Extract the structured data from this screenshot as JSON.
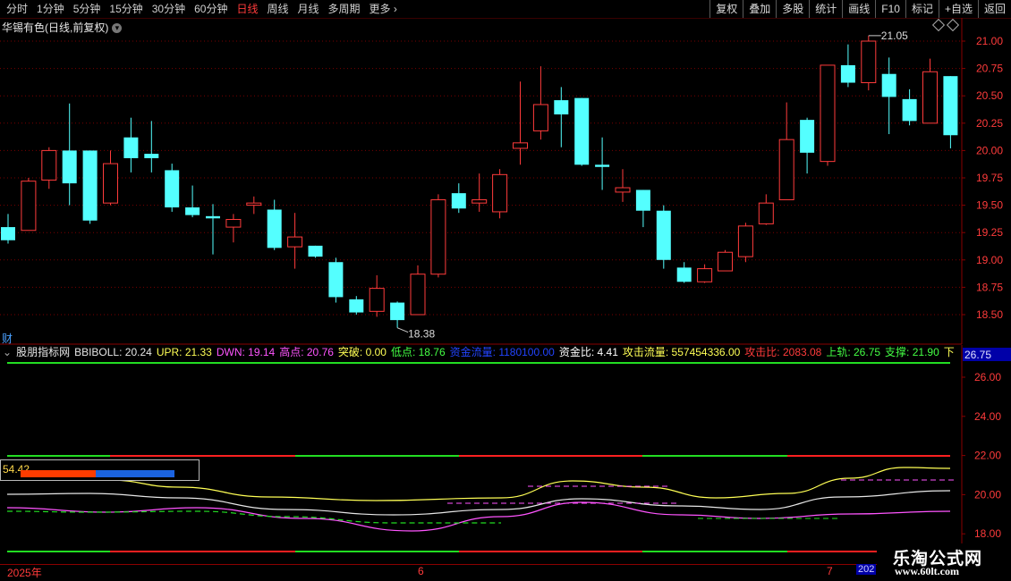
{
  "toolbar": {
    "periods": [
      "分时",
      "1分钟",
      "5分钟",
      "15分钟",
      "30分钟",
      "60分钟",
      "日线",
      "周线",
      "月线",
      "多周期",
      "更多 ›"
    ],
    "active_period": "日线",
    "right_buttons": [
      "复权",
      "叠加",
      "多股",
      "统计",
      "画线",
      "F10",
      "标记",
      "+自选",
      "返回"
    ]
  },
  "stock": {
    "title": "华锡有色(日线,前复权)"
  },
  "main_chart": {
    "price_axis": [
      "21.00",
      "20.75",
      "20.50",
      "20.25",
      "20.00",
      "19.75",
      "19.50",
      "19.25",
      "19.00",
      "18.75",
      "18.50"
    ],
    "high_label": "21.05",
    "low_label": "18.38",
    "up_color": "#ff3b3b",
    "down_color": "#54ffff",
    "candles": [
      [
        19.3,
        19.18,
        19.42,
        19.15
      ],
      [
        19.27,
        19.72,
        19.75,
        19.27
      ],
      [
        19.73,
        20.0,
        20.03,
        19.65
      ],
      [
        20.0,
        19.7,
        20.43,
        19.5
      ],
      [
        20.0,
        19.36,
        20.0,
        19.33
      ],
      [
        19.52,
        19.88,
        20.0,
        19.5
      ],
      [
        20.12,
        19.93,
        20.3,
        19.8
      ],
      [
        19.97,
        19.93,
        20.27,
        19.8
      ],
      [
        19.82,
        19.48,
        19.88,
        19.44
      ],
      [
        19.48,
        19.41,
        19.68,
        19.39
      ],
      [
        19.4,
        19.38,
        19.51,
        19.05
      ],
      [
        19.3,
        19.37,
        19.42,
        19.16
      ],
      [
        19.5,
        19.52,
        19.58,
        19.42
      ],
      [
        19.46,
        19.11,
        19.55,
        19.09
      ],
      [
        19.12,
        19.21,
        19.43,
        18.92
      ],
      [
        19.13,
        19.03,
        19.13,
        19.02
      ],
      [
        18.98,
        18.66,
        19.02,
        18.61
      ],
      [
        18.64,
        18.52,
        18.67,
        18.5
      ],
      [
        18.53,
        18.74,
        18.86,
        18.48
      ],
      [
        18.61,
        18.45,
        18.62,
        18.38
      ],
      [
        18.5,
        18.87,
        18.95,
        18.5
      ],
      [
        18.87,
        19.55,
        19.6,
        18.84
      ],
      [
        19.61,
        19.47,
        19.7,
        19.43
      ],
      [
        19.52,
        19.55,
        19.79,
        19.44
      ],
      [
        19.44,
        19.78,
        19.83,
        19.38
      ],
      [
        20.02,
        20.07,
        20.63,
        19.87
      ],
      [
        20.18,
        20.42,
        20.77,
        20.1
      ],
      [
        20.46,
        20.33,
        20.58,
        20.03
      ],
      [
        20.48,
        19.87,
        20.48,
        19.86
      ],
      [
        19.87,
        19.85,
        20.12,
        19.64
      ],
      [
        19.62,
        19.66,
        19.83,
        19.53
      ],
      [
        19.64,
        19.45,
        19.64,
        19.3
      ],
      [
        19.45,
        19.0,
        19.5,
        18.92
      ],
      [
        18.93,
        18.8,
        18.98,
        18.79
      ],
      [
        18.8,
        18.92,
        18.96,
        18.79
      ],
      [
        18.9,
        19.07,
        19.09,
        18.9
      ],
      [
        19.03,
        19.31,
        19.34,
        18.98
      ],
      [
        19.33,
        19.52,
        19.6,
        19.32
      ],
      [
        19.55,
        20.1,
        20.44,
        19.55
      ],
      [
        20.28,
        19.98,
        20.3,
        19.79
      ],
      [
        19.9,
        20.78,
        20.78,
        19.86
      ],
      [
        20.78,
        20.62,
        20.97,
        20.58
      ],
      [
        20.62,
        21.0,
        21.05,
        20.55
      ],
      [
        20.7,
        20.49,
        20.85,
        20.15
      ],
      [
        20.47,
        20.27,
        20.56,
        20.23
      ],
      [
        20.25,
        20.72,
        20.84,
        20.25
      ],
      [
        20.68,
        20.14,
        20.68,
        20.02
      ]
    ]
  },
  "indicator": {
    "name": "股朋指标网",
    "fields": [
      {
        "label": "BBIBOLL:",
        "value": "20.24",
        "color": "#e6e6e6"
      },
      {
        "label": "UPR:",
        "value": "21.33",
        "color": "#ffff55"
      },
      {
        "label": "DWN:",
        "value": "19.14",
        "color": "#ff55ff"
      },
      {
        "label": "高点:",
        "value": "20.76",
        "color": "#ff55ff"
      },
      {
        "label": "突破:",
        "value": "0.00",
        "color": "#ffff55"
      },
      {
        "label": "低点:",
        "value": "18.76",
        "color": "#44ff44"
      },
      {
        "label": "资金流量:",
        "value": "1180100.00",
        "color": "#2244ff"
      },
      {
        "label": "资金比:",
        "value": "4.41",
        "color": "#ffffff"
      },
      {
        "label": "攻击流量:",
        "value": "557454336.00",
        "color": "#ffff55"
      },
      {
        "label": "攻击比:",
        "value": "2083.08",
        "color": "#ff3b3b"
      },
      {
        "label": "上轨:",
        "value": "26.75",
        "color": "#44ff44"
      },
      {
        "label": "支撑:",
        "value": "21.90",
        "color": "#44ff44"
      },
      {
        "label": "下",
        "value": "",
        "color": "#ffff55"
      }
    ],
    "axis": [
      "26.00",
      "24.00",
      "22.00",
      "20.00",
      "18.00"
    ],
    "current_badge": "26.75",
    "gauge_value": "54.42"
  },
  "cai_label": "财",
  "time_axis": {
    "labels": [
      "2025年",
      "6",
      "7"
    ],
    "last": "202"
  },
  "watermark": {
    "line1": "乐淘公式网",
    "line2": "www.60lt.com"
  }
}
